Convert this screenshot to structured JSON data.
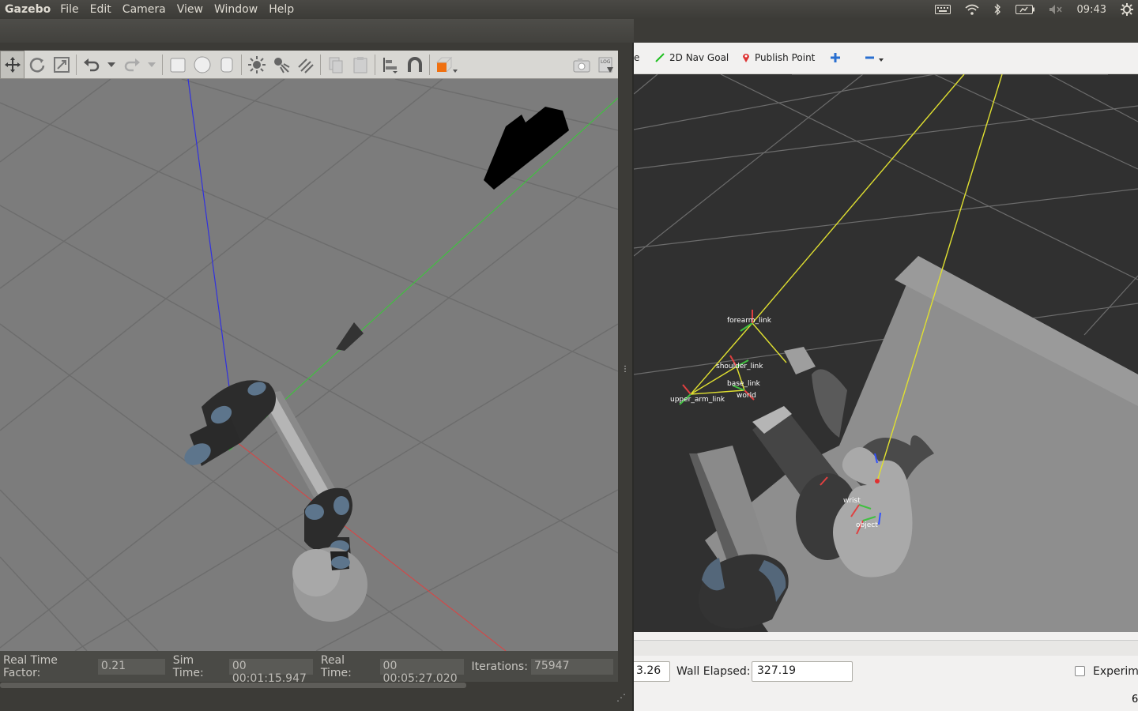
{
  "topbar": {
    "app_name": "Gazebo",
    "menus": [
      "File",
      "Edit",
      "Camera",
      "View",
      "Window",
      "Help"
    ],
    "clock": "09:43"
  },
  "rviz": {
    "tools": {
      "nav_goal": "2D Nav Goal",
      "publish_point": "Publish Point",
      "cut_label": "e"
    },
    "frames": [
      "forearm_link",
      "shoulder_link",
      "base_link",
      "world",
      "upper_arm_link",
      "wrist",
      "object"
    ],
    "status": {
      "ros_elapsed_value": "3.26",
      "wall_elapsed_label": "Wall Elapsed:",
      "wall_elapsed_value": "327.19",
      "experimental_label": "Experime",
      "fps": "6"
    }
  },
  "gazebo": {
    "status": {
      "rtf_label": "Real Time Factor:",
      "rtf_value": "0.21",
      "sim_time_label": "Sim Time:",
      "sim_time_value": "00 00:01:15.947",
      "real_time_label": "Real Time:",
      "real_time_value": "00 00:05:27.020",
      "iterations_label": "Iterations:",
      "iterations_value": "75947"
    }
  },
  "colors": {
    "gazebo_ground": "#7c7c7c",
    "rviz_background": "#303030",
    "grid_line": "#6c6c6c",
    "axis_x": "#e04040",
    "axis_y": "#40c040",
    "axis_z": "#3030e0",
    "accent_orange": "#f07010"
  }
}
